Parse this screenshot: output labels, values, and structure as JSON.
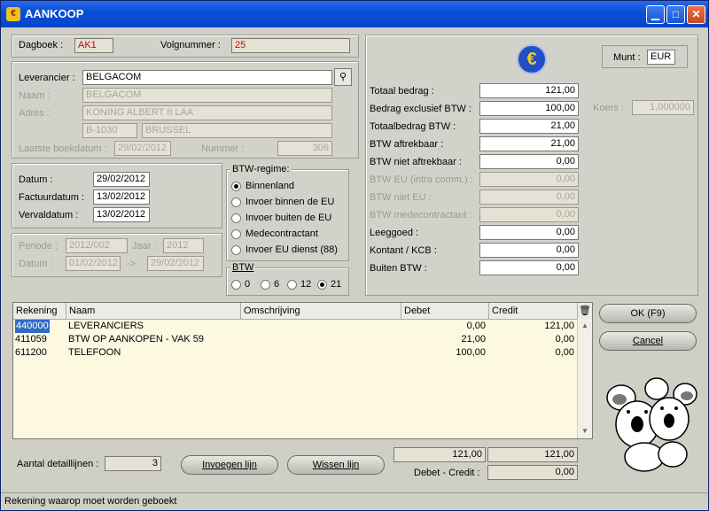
{
  "window": {
    "title": "AANKOOP"
  },
  "header": {
    "dagboek_label": "Dagboek :",
    "dagboek_value": "AK1",
    "volgnummer_label": "Volgnummer :",
    "volgnummer_value": "25"
  },
  "supplier": {
    "leverancier_label": "Leverancier :",
    "leverancier_value": "BELGACOM",
    "naam_label": "Naam :",
    "naam_value": "BELGACOM",
    "adres_label": "Adres :",
    "adres_street": "KONING ALBERT II LAA",
    "postcode": "B-1030",
    "city": "BRUSSEL",
    "laatste_label": "Laatste boekdatum :",
    "laatste_value": "29/02/2012",
    "nummer_label": "Nummer :",
    "nummer_value": "306"
  },
  "dates": {
    "datum_label": "Datum :",
    "datum_value": "29/02/2012",
    "factuur_label": "Factuurdatum :",
    "factuur_value": "13/02/2012",
    "verval_label": "Vervaldatum :",
    "verval_value": "13/02/2012"
  },
  "period": {
    "periode_label": "Periode :",
    "periode_value": "2012/002",
    "jaar_label": "Jaar :",
    "jaar_value": "2012",
    "datum_label": "Datum :",
    "from": "01/02/2012",
    "arrow": "->",
    "to": "29/02/2012"
  },
  "btw_regime": {
    "title": "BTW-regime:",
    "options": [
      "Binnenland",
      "Invoer binnen de EU",
      "Invoer buiten de EU",
      "Medecontractant",
      "Invoer EU dienst (88)"
    ],
    "selected": 0
  },
  "btw_rate": {
    "title": "BTW",
    "options": [
      "0",
      "6",
      "12",
      "21"
    ],
    "selected": 3
  },
  "currency": {
    "label": "Munt :",
    "value": "EUR",
    "koers_label": "Koers :",
    "koers_value": "1,000000",
    "icon": "euro-icon"
  },
  "totals": [
    {
      "label": "Totaal bedrag :",
      "value": "121,00",
      "enabled": true
    },
    {
      "label": "Bedrag exclusief BTW :",
      "value": "100,00",
      "enabled": true
    },
    {
      "label": "Totaalbedrag BTW :",
      "value": "21,00",
      "enabled": true
    },
    {
      "label": "BTW aftrekbaar :",
      "value": "21,00",
      "enabled": true
    },
    {
      "label": "BTW niet aftrekbaar :",
      "value": "0,00",
      "enabled": true
    },
    {
      "label": "BTW EU (intra comm.) :",
      "value": "0,00",
      "enabled": false
    },
    {
      "label": "BTW niet EU :",
      "value": "0,00",
      "enabled": false
    },
    {
      "label": "BTW medecontractant :",
      "value": "0,00",
      "enabled": false
    },
    {
      "label": "Leeggoed :",
      "value": "0,00",
      "enabled": true
    },
    {
      "label": "Kontant / KCB :",
      "value": "0,00",
      "enabled": true
    },
    {
      "label": "Buiten BTW :",
      "value": "0,00",
      "enabled": true
    }
  ],
  "grid": {
    "columns": [
      "Rekening",
      "Naam",
      "Omschrijving",
      "Debet",
      "Credit"
    ],
    "rows": [
      {
        "rekening": "440000",
        "naam": "LEVERANCIERS",
        "omschrijving": "",
        "debet": "0,00",
        "credit": "121,00"
      },
      {
        "rekening": "411059",
        "naam": "BTW OP AANKOPEN - VAK 59",
        "omschrijving": "",
        "debet": "21,00",
        "credit": "0,00"
      },
      {
        "rekening": "611200",
        "naam": "TELEFOON",
        "omschrijving": "",
        "debet": "100,00",
        "credit": "0,00"
      }
    ]
  },
  "buttons": {
    "ok": "OK (F9)",
    "cancel": "Cancel",
    "invoegen": "Invoegen lijn",
    "wissen": "Wissen lijn"
  },
  "footer": {
    "aantal_label": "Aantal detaillijnen :",
    "aantal_value": "3",
    "sum_debet": "121,00",
    "sum_credit": "121,00",
    "diff_label": "Debet - Credit :",
    "diff_value": "0,00"
  },
  "status": "Rekening waarop moet worden geboekt"
}
